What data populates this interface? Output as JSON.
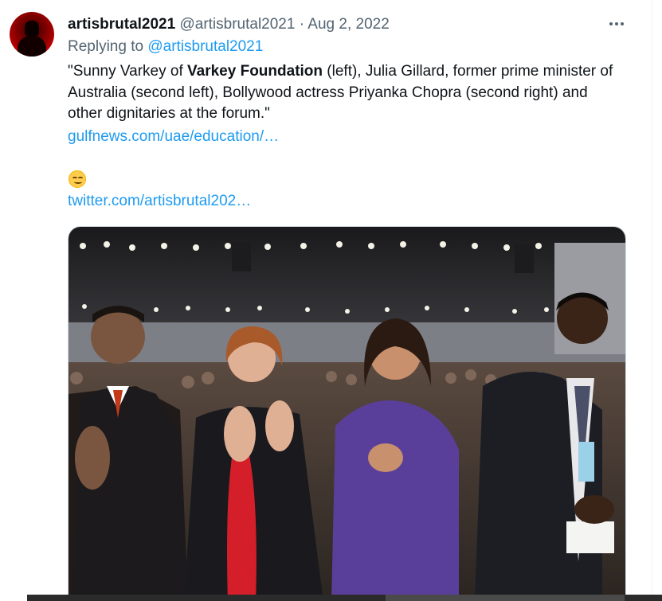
{
  "tweet": {
    "display_name": "artisbrutal2021",
    "handle": "@artisbrutal2021",
    "separator": "·",
    "date": "Aug 2, 2022",
    "replying_prefix": "Replying to ",
    "replying_mention": "@artisbrutal2021",
    "text_before_bold": "\"Sunny Varkey of ",
    "text_bold": "Varkey Foundation",
    "text_after_bold": " (left), Julia Gillard, former prime minister of Australia (second left), Bollywood actress Priyanka Chopra (second right) and other dignitaries at the forum.\"",
    "link_1": "gulfnews.com/uae/education/…",
    "emoji": "smirking-face-emoji",
    "link_2": "twitter.com/artisbrutal202…"
  },
  "colors": {
    "link": "#1d9bf0",
    "secondary_text": "#536471",
    "primary_text": "#0f1419",
    "avatar": "#c40000"
  }
}
